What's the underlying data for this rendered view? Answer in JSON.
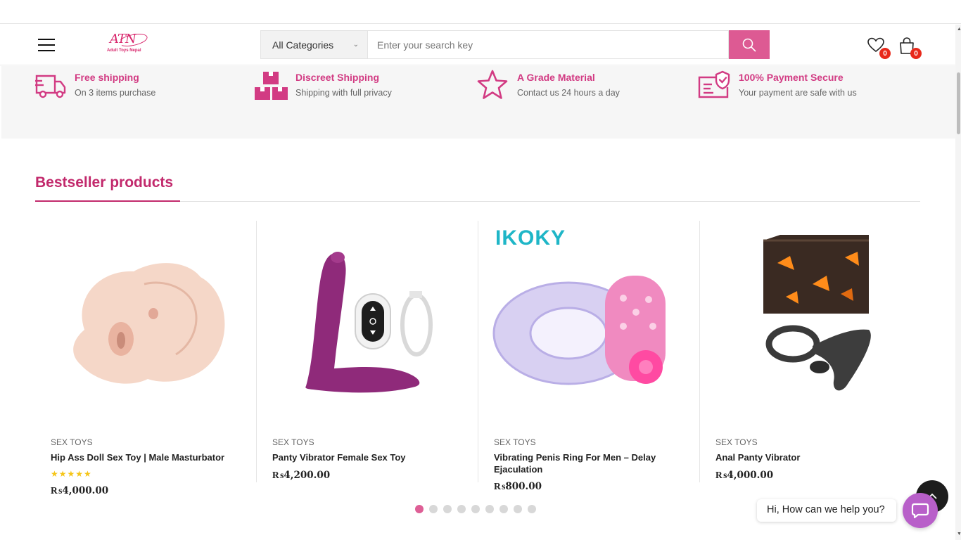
{
  "header": {
    "logo_text": "ATN",
    "logo_tagline": "Adult Toys Nepal",
    "category_select": "All Categories",
    "search_placeholder": "Enter your search key",
    "wishlist_count": "0",
    "cart_count": "0"
  },
  "features": [
    {
      "title": "Free shipping",
      "subtitle": "On 3 items purchase",
      "icon": "truck-icon"
    },
    {
      "title": "Discreet Shipping",
      "subtitle": "Shipping with full privacy",
      "icon": "boxes-icon"
    },
    {
      "title": "A Grade Material",
      "subtitle": "Contact us 24 hours a day",
      "icon": "star-icon"
    },
    {
      "title": "100% Payment Secure",
      "subtitle": "Your payment are safe with us",
      "icon": "secure-payment-icon"
    }
  ],
  "section": {
    "title": "Bestseller products"
  },
  "products": [
    {
      "category": "SEX TOYS",
      "name": "Hip Ass Doll Sex Toy | Male Masturbator",
      "price": "₨4,000.00",
      "rating": "★★★★★"
    },
    {
      "category": "SEX TOYS",
      "name": "Panty Vibrator Female Sex Toy",
      "price": "₨4,200.00"
    },
    {
      "category": "SEX TOYS",
      "name": "Vibrating Penis Ring For Men – Delay Ejaculation",
      "price": "₨800.00",
      "brand": "IKOKY"
    },
    {
      "category": "SEX TOYS",
      "name": "Anal Panty Vibrator",
      "price": "₨4,000.00"
    }
  ],
  "carousel": {
    "pages": 9,
    "active": 0
  },
  "chat": {
    "greeting": "Hi, How can we help you?"
  },
  "colors": {
    "accent": "#c2296c",
    "button": "#dd5a93",
    "badge": "#e8291b"
  }
}
